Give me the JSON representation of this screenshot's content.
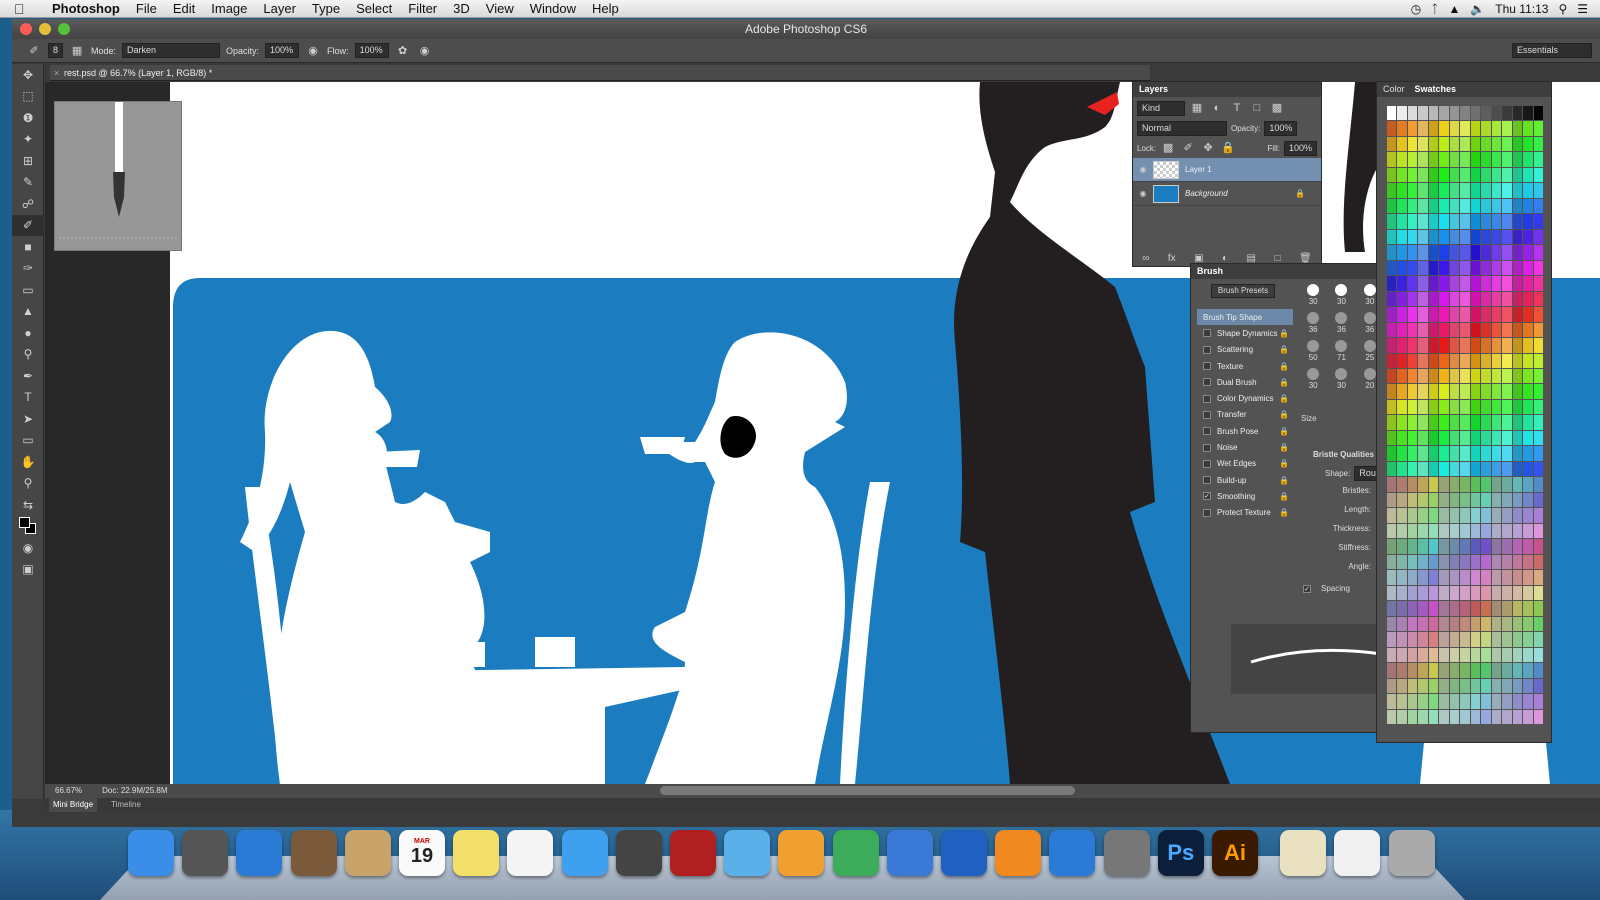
{
  "menubar": {
    "app": "Photoshop",
    "items": [
      "File",
      "Edit",
      "Image",
      "Layer",
      "Type",
      "Select",
      "Filter",
      "3D",
      "View",
      "Window",
      "Help"
    ],
    "clock": "Thu 11:13"
  },
  "window": {
    "title": "Adobe Photoshop CS6"
  },
  "options": {
    "brush_size": "8",
    "mode_label": "Mode:",
    "mode_value": "Darken",
    "opacity_label": "Opacity:",
    "opacity_value": "100%",
    "flow_label": "Flow:",
    "flow_value": "100%",
    "workspace": "Essentials"
  },
  "document": {
    "tab": "rest.psd @ 66.7% (Layer 1, RGB/8) *"
  },
  "status": {
    "zoom": "66.67%",
    "doc": "Doc: 22.9M/25.8M"
  },
  "bottom_tabs": [
    "Mini Bridge",
    "Timeline"
  ],
  "layers_panel": {
    "title": "Layers",
    "filter": "Kind",
    "blend": "Normal",
    "opacity_label": "Opacity:",
    "opacity": "100%",
    "lock_label": "Lock:",
    "fill_label": "Fill:",
    "fill": "100%",
    "layers": [
      {
        "name": "Layer 1",
        "selected": true
      },
      {
        "name": "Background",
        "selected": false
      }
    ]
  },
  "color_panel": {
    "tabs": [
      "Color",
      "Swatches"
    ]
  },
  "brush_panel": {
    "title": "Brush",
    "presets_button": "Brush Presets",
    "tip_shape": "Brush Tip Shape",
    "options": [
      {
        "label": "Shape Dynamics",
        "checked": false
      },
      {
        "label": "Scattering",
        "checked": false
      },
      {
        "label": "Texture",
        "checked": false
      },
      {
        "label": "Dual Brush",
        "checked": false
      },
      {
        "label": "Color Dynamics",
        "checked": false
      },
      {
        "label": "Transfer",
        "checked": false
      },
      {
        "label": "Brush Pose",
        "checked": false
      },
      {
        "label": "Noise",
        "checked": false
      },
      {
        "label": "Wet Edges",
        "checked": false
      },
      {
        "label": "Build-up",
        "checked": false
      },
      {
        "label": "Smoothing",
        "checked": true
      },
      {
        "label": "Protect Texture",
        "checked": false
      }
    ],
    "tip_sizes": [
      "30",
      "30",
      "30",
      "36",
      "36",
      "36",
      "50",
      "71",
      "25",
      "30",
      "30",
      "20"
    ],
    "size_label": "Size",
    "bristle_title": "Bristle Qualities",
    "shape_label": "Shape:",
    "shape_value": "Roun",
    "bristle_fields": [
      "Bristles:",
      "Length:",
      "Thickness:",
      "Stiffness:",
      "Angle:"
    ],
    "spacing_label": "Spacing"
  },
  "colors": {
    "canvas_blue": "#1b7dbf",
    "silhouette": "#231f20",
    "lips": "#e8231f",
    "layer_selected": "#7390b0"
  },
  "dock": [
    "Finder",
    "Launchpad",
    "Safari",
    "Mail",
    "Contacts",
    "Calendar",
    "Notes",
    "Reminders",
    "Messages",
    "FaceTime",
    "Photo Booth",
    "iPhoto",
    "Pages",
    "Numbers",
    "Keynote",
    "iTunes",
    "iBooks",
    "App Store",
    "System Preferences",
    "Photoshop",
    "Illustrator",
    "Burger",
    "Documents",
    "Trash"
  ],
  "dock_calendar": {
    "month": "MAR",
    "day": "19"
  },
  "dock_badges": {
    "photoshop": "Ps",
    "illustrator": "Ai"
  }
}
